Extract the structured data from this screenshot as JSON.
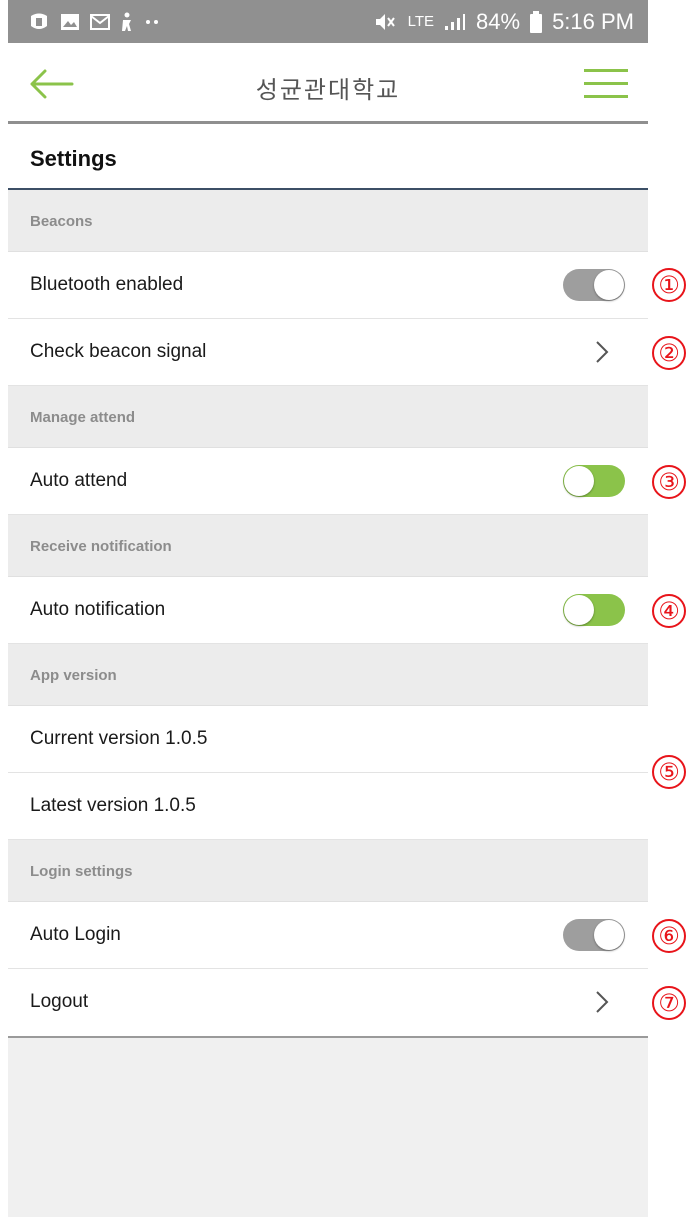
{
  "status_bar": {
    "left_icons": [
      "app-notification-icon",
      "image-icon",
      "mail-icon",
      "accessibility-icon",
      "more-dots-icon"
    ],
    "lte_label": "LTE",
    "battery_percent": "84%",
    "time": "5:16 PM"
  },
  "app_bar": {
    "title": "성균관대학교",
    "accent_color": "#8bc34a"
  },
  "page": {
    "title": "Settings"
  },
  "sections": {
    "beacons": "Beacons",
    "manage_attend": "Manage attend",
    "receive_notification": "Receive notification",
    "app_version": "App version",
    "login_settings": "Login settings"
  },
  "items": {
    "bluetooth": {
      "label": "Bluetooth enabled",
      "toggle_on": false
    },
    "check_beacon": {
      "label": "Check beacon signal"
    },
    "auto_attend": {
      "label": "Auto attend",
      "toggle_on": true
    },
    "auto_notification": {
      "label": "Auto notification",
      "toggle_on": true
    },
    "current_version": {
      "label": "Current version 1.0.5"
    },
    "latest_version": {
      "label": "Latest version 1.0.5"
    },
    "auto_login": {
      "label": "Auto Login",
      "toggle_on": false
    },
    "logout": {
      "label": "Logout"
    }
  },
  "markers": [
    "①",
    "②",
    "③",
    "④",
    "⑤",
    "⑥",
    "⑦"
  ],
  "colors": {
    "annotation": "#e8141a",
    "toggle_off": "#9e9e9e",
    "toggle_on": "#8bc34a"
  }
}
